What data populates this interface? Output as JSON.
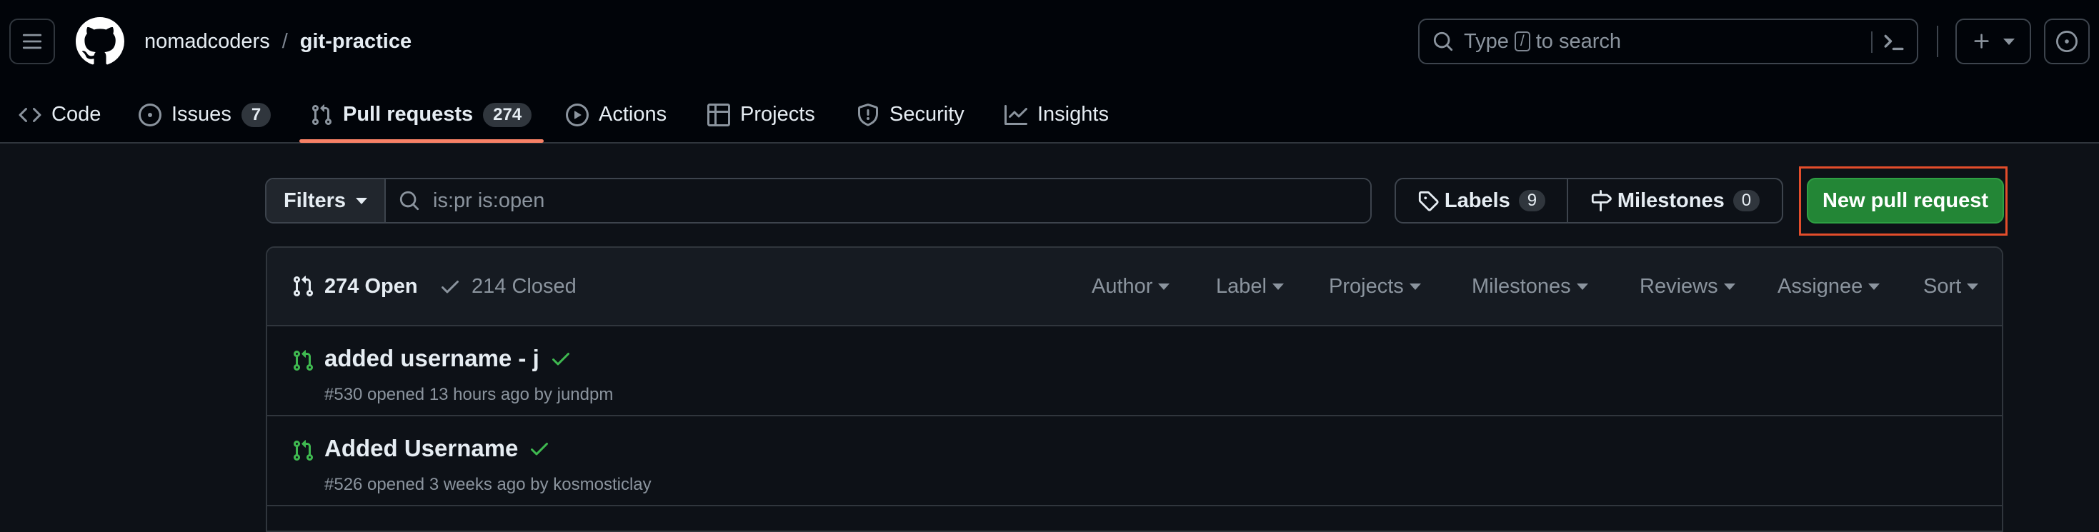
{
  "header": {
    "owner": "nomadcoders",
    "separator": "/",
    "repo": "git-practice",
    "search": {
      "prefix": "Type",
      "key": "/",
      "suffix": "to search"
    }
  },
  "nav": {
    "tabs": [
      {
        "label": "Code",
        "icon": "code-icon"
      },
      {
        "label": "Issues",
        "count": "7",
        "icon": "issue-opened-icon"
      },
      {
        "label": "Pull requests",
        "count": "274",
        "icon": "git-pull-request-icon",
        "active": true
      },
      {
        "label": "Actions",
        "icon": "play-icon"
      },
      {
        "label": "Projects",
        "icon": "table-icon"
      },
      {
        "label": "Security",
        "icon": "shield-icon"
      },
      {
        "label": "Insights",
        "icon": "graph-icon"
      }
    ]
  },
  "filters": {
    "button_label": "Filters",
    "query": "is:pr is:open"
  },
  "labels": {
    "label": "Labels",
    "count": "9"
  },
  "milestones": {
    "label": "Milestones",
    "count": "0"
  },
  "new_pr_label": "New pull request",
  "list": {
    "open_label": "274 Open",
    "closed_label": "214 Closed",
    "sorters": [
      "Author",
      "Label",
      "Projects",
      "Milestones",
      "Reviews",
      "Assignee",
      "Sort"
    ],
    "rows": [
      {
        "title": "added username - j",
        "meta": "#530 opened 13 hours ago by jundpm",
        "status": "success"
      },
      {
        "title": "Added Username",
        "meta": "#526 opened 3 weeks ago by kosmosticlay",
        "status": "success"
      }
    ]
  },
  "colors": {
    "accent_green": "#238636",
    "check_green": "#3fb950",
    "underline_orange": "#f78166",
    "highlight_red": "#e34d2b"
  }
}
